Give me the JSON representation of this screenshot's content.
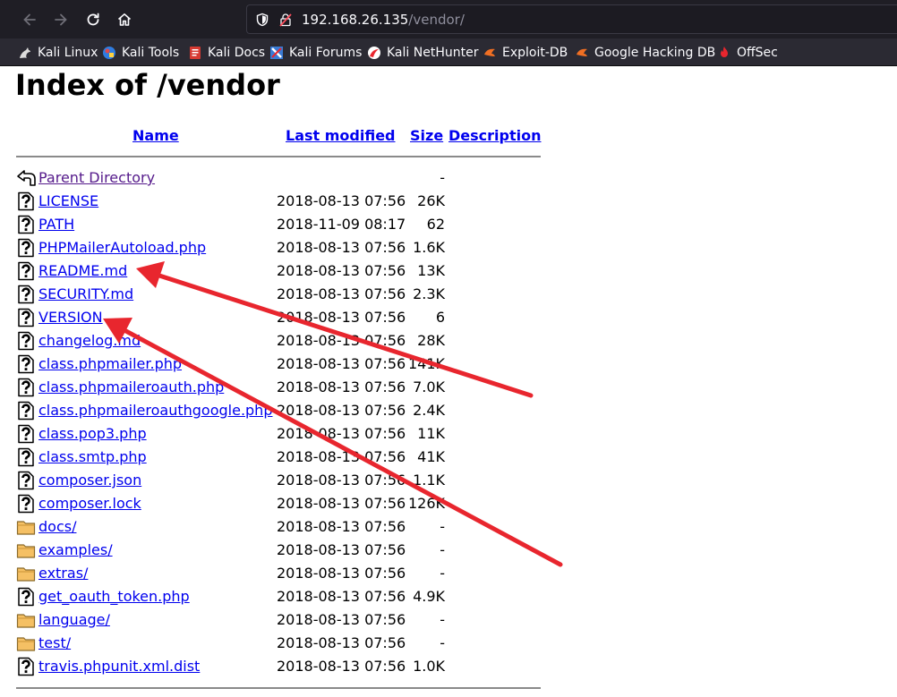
{
  "browser": {
    "url_host": "192.168.26.135",
    "url_path": "/vendor/"
  },
  "bookmarks": [
    {
      "label": "Kali Linux",
      "icon": "kali-dragon-icon"
    },
    {
      "label": "Kali Tools",
      "icon": "kali-tools-icon"
    },
    {
      "label": "Kali Docs",
      "icon": "kali-docs-icon"
    },
    {
      "label": "Kali Forums",
      "icon": "kali-forums-icon"
    },
    {
      "label": "Kali NetHunter",
      "icon": "nethunter-icon"
    },
    {
      "label": "Exploit-DB",
      "icon": "exploit-db-icon"
    },
    {
      "label": "Google Hacking DB",
      "icon": "ghdb-icon"
    },
    {
      "label": "OffSec",
      "icon": "offsec-icon"
    }
  ],
  "page": {
    "title": "Index of /vendor",
    "columns": {
      "name": "Name",
      "last_modified": "Last modified",
      "size": "Size",
      "description": "Description"
    }
  },
  "entries": [
    {
      "name": "Parent Directory",
      "modified": "",
      "size": "-",
      "icon": "back-icon"
    },
    {
      "name": "LICENSE",
      "modified": "2018-08-13 07:56",
      "size": "26K",
      "icon": "unknown-file-icon"
    },
    {
      "name": "PATH",
      "modified": "2018-11-09 08:17",
      "size": "62",
      "icon": "unknown-file-icon"
    },
    {
      "name": "PHPMailerAutoload.php",
      "modified": "2018-08-13 07:56",
      "size": "1.6K",
      "icon": "unknown-file-icon"
    },
    {
      "name": "README.md",
      "modified": "2018-08-13 07:56",
      "size": "13K",
      "icon": "unknown-file-icon"
    },
    {
      "name": "SECURITY.md",
      "modified": "2018-08-13 07:56",
      "size": "2.3K",
      "icon": "unknown-file-icon"
    },
    {
      "name": "VERSION",
      "modified": "2018-08-13 07:56",
      "size": "6",
      "icon": "unknown-file-icon"
    },
    {
      "name": "changelog.md",
      "modified": "2018-08-13 07:56",
      "size": "28K",
      "icon": "unknown-file-icon"
    },
    {
      "name": "class.phpmailer.php",
      "modified": "2018-08-13 07:56",
      "size": "141K",
      "icon": "unknown-file-icon"
    },
    {
      "name": "class.phpmaileroauth.php",
      "modified": "2018-08-13 07:56",
      "size": "7.0K",
      "icon": "unknown-file-icon"
    },
    {
      "name": "class.phpmaileroauthgoogle.php",
      "modified": "2018-08-13 07:56",
      "size": "2.4K",
      "icon": "unknown-file-icon"
    },
    {
      "name": "class.pop3.php",
      "modified": "2018-08-13 07:56",
      "size": "11K",
      "icon": "unknown-file-icon"
    },
    {
      "name": "class.smtp.php",
      "modified": "2018-08-13 07:56",
      "size": "41K",
      "icon": "unknown-file-icon"
    },
    {
      "name": "composer.json",
      "modified": "2018-08-13 07:56",
      "size": "1.1K",
      "icon": "unknown-file-icon"
    },
    {
      "name": "composer.lock",
      "modified": "2018-08-13 07:56",
      "size": "126K",
      "icon": "unknown-file-icon"
    },
    {
      "name": "docs/",
      "modified": "2018-08-13 07:56",
      "size": "-",
      "icon": "folder-icon"
    },
    {
      "name": "examples/",
      "modified": "2018-08-13 07:56",
      "size": "-",
      "icon": "folder-icon"
    },
    {
      "name": "extras/",
      "modified": "2018-08-13 07:56",
      "size": "-",
      "icon": "folder-icon"
    },
    {
      "name": "get_oauth_token.php",
      "modified": "2018-08-13 07:56",
      "size": "4.9K",
      "icon": "unknown-file-icon"
    },
    {
      "name": "language/",
      "modified": "2018-08-13 07:56",
      "size": "-",
      "icon": "folder-icon"
    },
    {
      "name": "test/",
      "modified": "2018-08-13 07:56",
      "size": "-",
      "icon": "folder-icon"
    },
    {
      "name": "travis.phpunit.xml.dist",
      "modified": "2018-08-13 07:56",
      "size": "1.0K",
      "icon": "unknown-file-icon"
    }
  ],
  "annotations": {
    "arrow_color": "#e8262e",
    "arrow_targets": [
      "README.md",
      "VERSION"
    ]
  }
}
